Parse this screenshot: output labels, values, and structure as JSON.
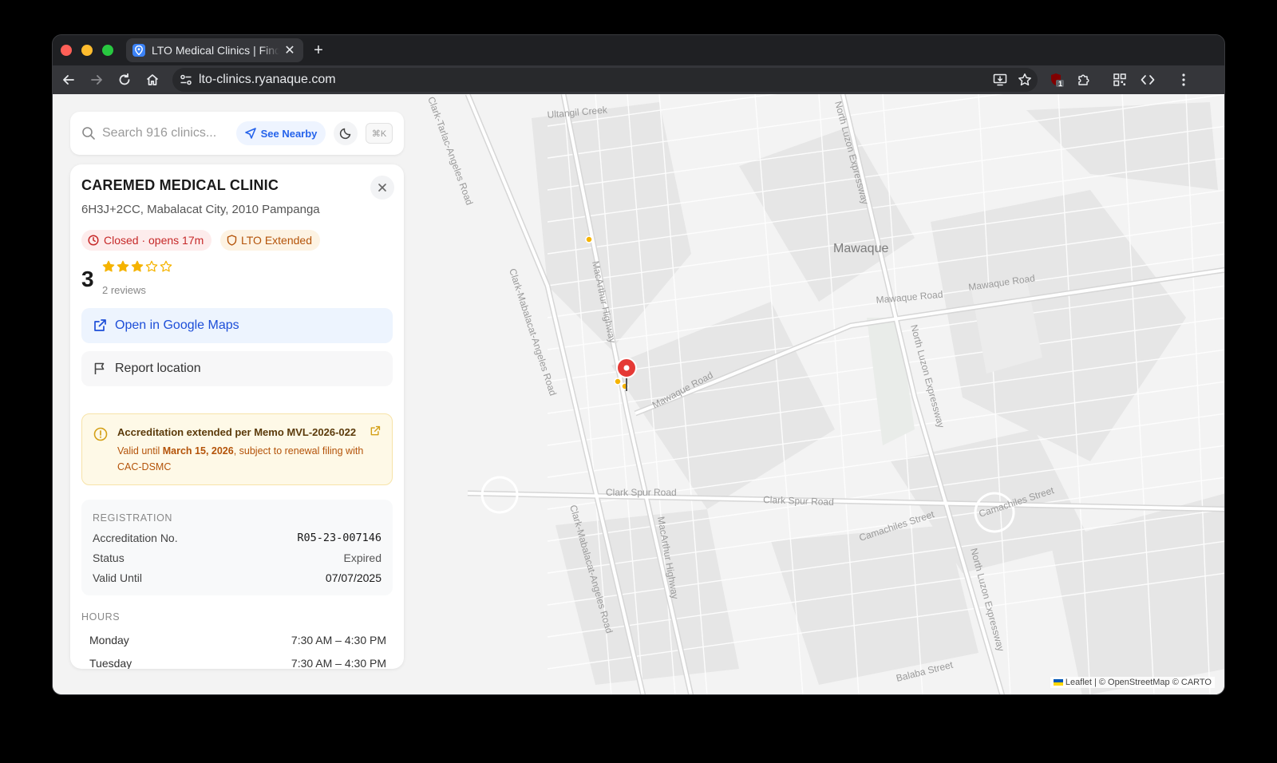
{
  "browser": {
    "tab_title": "LTO Medical Clinics | Find",
    "url": "lto-clinics.ryanaque.com",
    "extension_badge": "1"
  },
  "search": {
    "placeholder": "Search 916 clinics...",
    "nearby_label": "See Nearby",
    "shortcut": "⌘K"
  },
  "clinic": {
    "name": "CAREMED MEDICAL CLINIC",
    "address": "6H3J+2CC, Mabalacat City, 2010 Pampanga",
    "status_badge": "Closed · opens 17m",
    "lto_badge": "LTO Extended",
    "rating": "3",
    "stars_filled": 3,
    "stars_total": 5,
    "reviews": "2 reviews",
    "gmaps_label": "Open in Google Maps",
    "report_label": "Report location"
  },
  "notice": {
    "title": "Accreditation extended per Memo MVL-2026-022",
    "body_prefix": "Valid until ",
    "body_date": "March 15, 2026",
    "body_suffix": ", subject to renewal filing with CAC-DSMC"
  },
  "registration": {
    "heading": "REGISTRATION",
    "rows": [
      {
        "label": "Accreditation No.",
        "value": "R05-23-007146"
      },
      {
        "label": "Status",
        "value": "Expired"
      },
      {
        "label": "Valid Until",
        "value": "07/07/2025"
      }
    ]
  },
  "hours": {
    "heading": "HOURS",
    "rows": [
      {
        "day": "Monday",
        "time": "7:30 AM – 4:30 PM"
      },
      {
        "day": "Tuesday",
        "time": "7:30 AM – 4:30 PM"
      }
    ]
  },
  "map": {
    "labels": {
      "area": "Mawaque",
      "creek": "Ultangil Creek",
      "nlex1": "North Luzon Expressway",
      "nlex2": "North Luzon Expressway",
      "nlex3": "North Luzon Expressway",
      "macarthur1": "MacArthur Highway",
      "macarthur2": "MacArthur Highway",
      "cmar1": "Clark-Mabalacat-Angeles Road",
      "cmar2": "Clark-Mabalacat-Angeles Road",
      "cmar_top": "Clark-Tarlac-Angeles Road",
      "mawaque_rd1": "Mawaque Road",
      "mawaque_rd2": "Mawaque Road",
      "mawaque_rd3": "Mawaque Road",
      "clark_spur1": "Clark Spur Road",
      "clark_spur2": "Clark Spur Road",
      "camachiles1": "Camachiles Street",
      "camachiles2": "Camachiles Street",
      "balaba": "Balaba Street"
    },
    "attribution_leaflet": "Leaflet",
    "attribution_rest": "| © OpenStreetMap © CARTO",
    "colors": {
      "marker": "#e53935",
      "cluster": "#f5b300"
    }
  }
}
